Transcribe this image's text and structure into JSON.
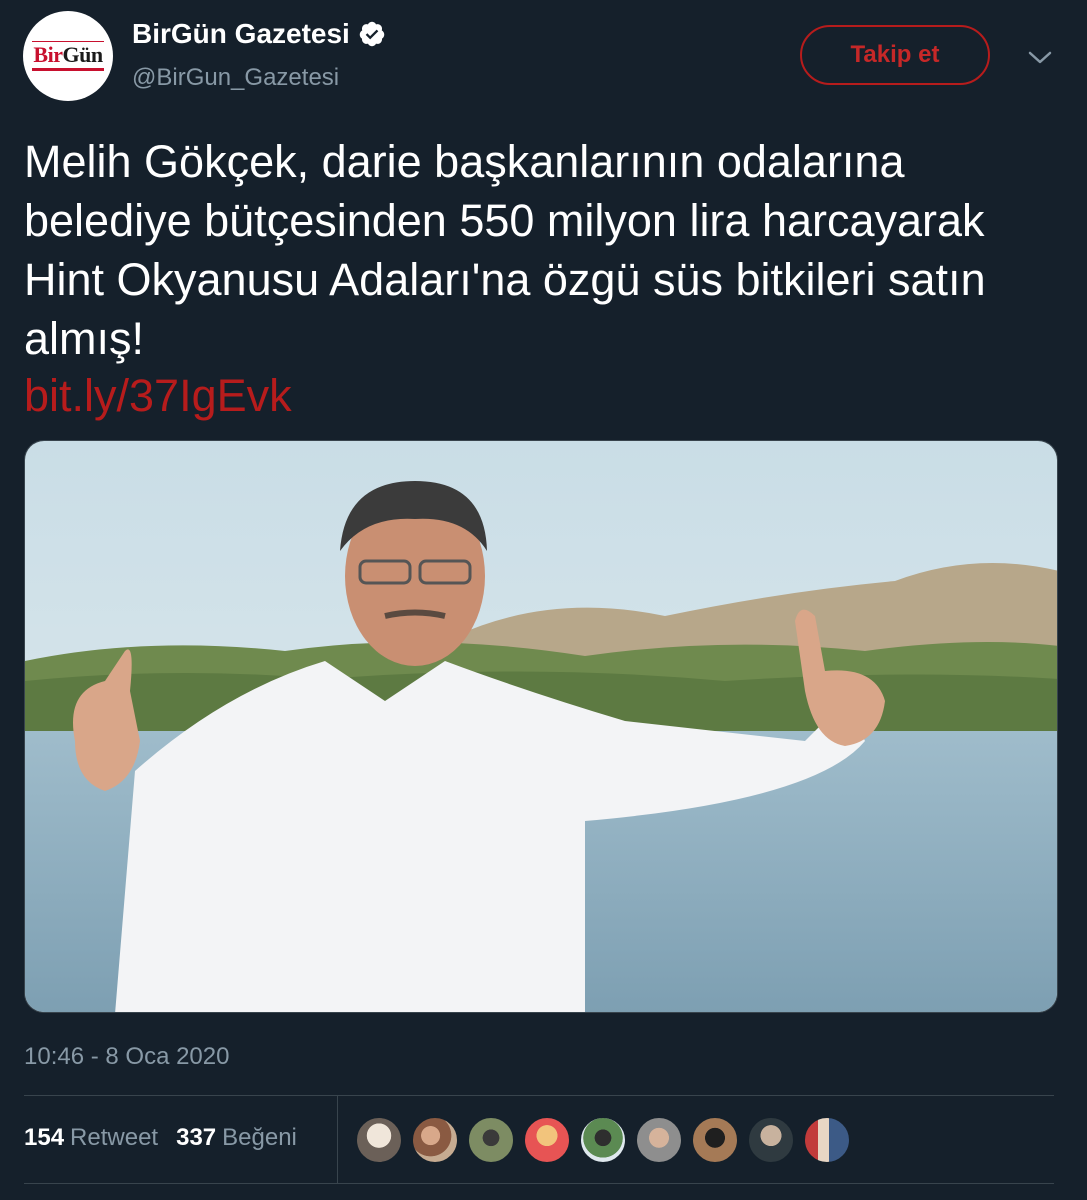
{
  "account": {
    "display_name": "BirGün Gazetesi",
    "handle": "@BirGun_Gazetesi",
    "logo_bir": "Bir",
    "logo_gun": "Gün",
    "verified_icon": "verified-badge-icon"
  },
  "follow_button": {
    "label": "Takip et"
  },
  "menu_icon": "chevron-down-icon",
  "tweet": {
    "text": "Melih Gökçek, darie başkanlarının odalarına belediye bütçesinden 550 milyon lira harcayarak Hint Okyanusu Adaları'na özgü süs bitkileri satın almış!",
    "link": "bit.ly/37IgEvk"
  },
  "timestamp": "10:46 - 8 Oca 2020",
  "stats": {
    "retweets_count": "154",
    "retweets_label": "Retweet",
    "likes_count": "337",
    "likes_label": "Beğeni"
  },
  "colors": {
    "background": "#15202b",
    "accent": "#b71c1c",
    "secondary_text": "#8899a6",
    "divider": "#38444d"
  }
}
